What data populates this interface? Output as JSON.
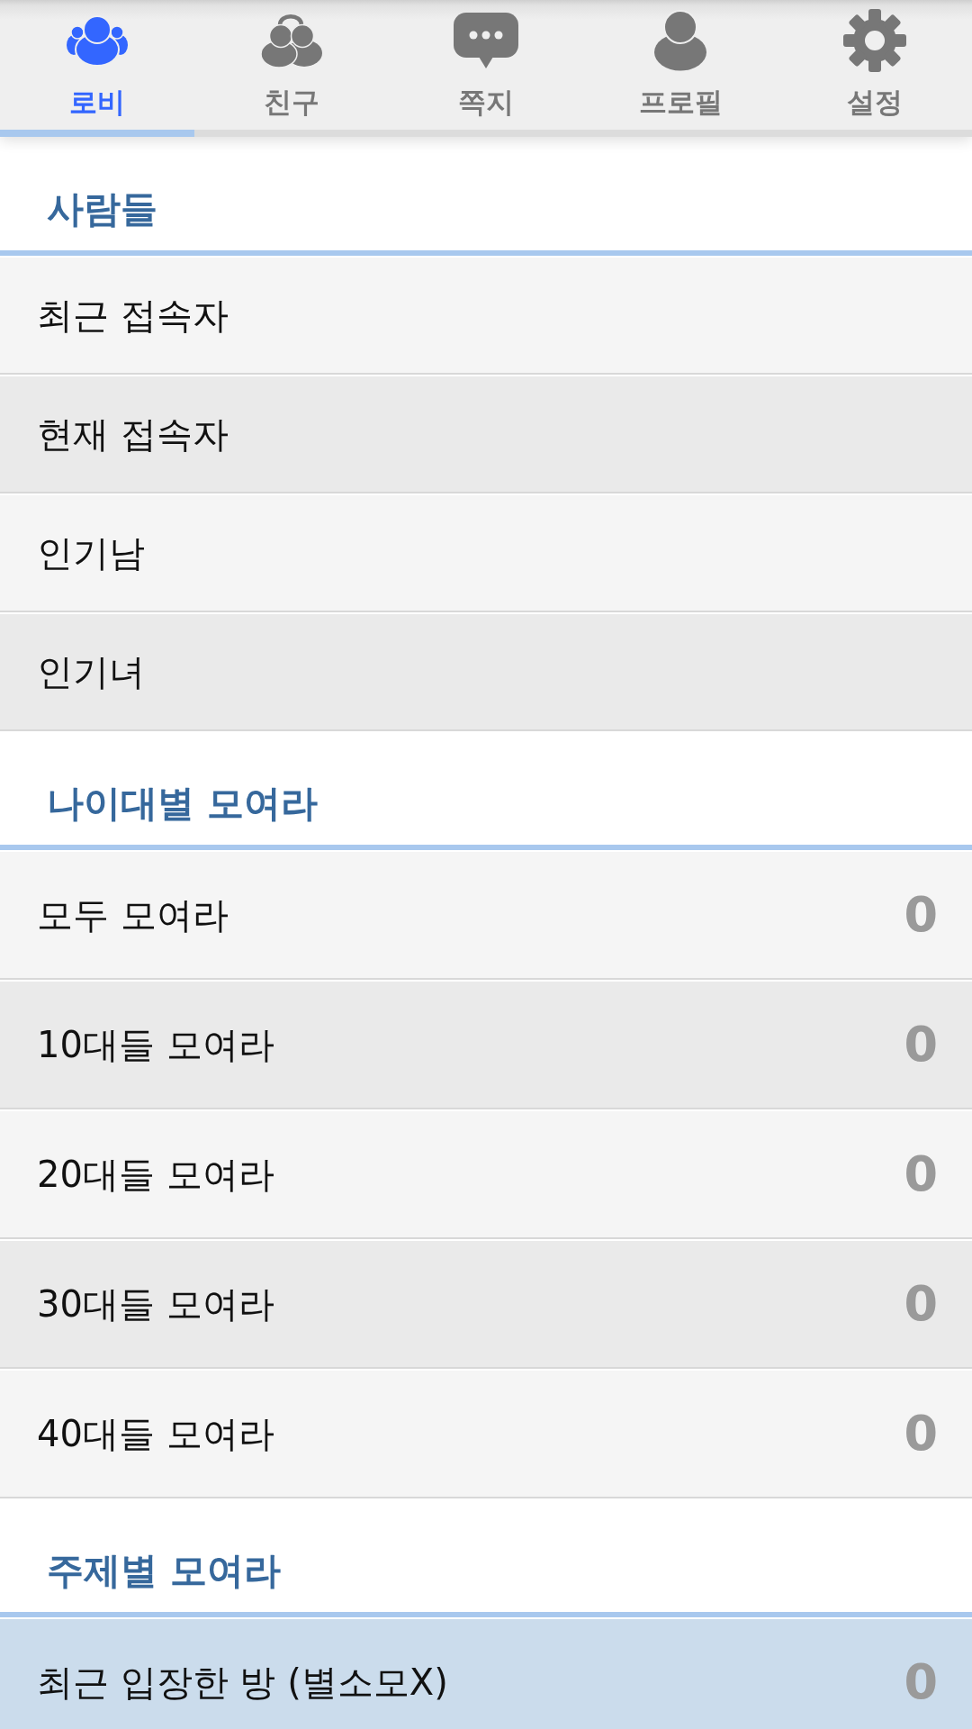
{
  "tabs": [
    {
      "kind": "lobby",
      "label": "로비",
      "selected": true
    },
    {
      "kind": "friends",
      "label": "친구",
      "selected": false
    },
    {
      "kind": "messages",
      "label": "쪽지",
      "selected": false
    },
    {
      "kind": "profile",
      "label": "프로필",
      "selected": false
    },
    {
      "kind": "settings",
      "label": "설정",
      "selected": false
    }
  ],
  "sections": [
    {
      "title": "사람들",
      "rows": [
        {
          "label": "최근 접속자",
          "selected": false
        },
        {
          "label": "현재 접속자",
          "selected": false
        },
        {
          "label": "인기남",
          "selected": false
        },
        {
          "label": "인기녀",
          "selected": false
        }
      ]
    },
    {
      "title": "나이대별 모여라",
      "rows": [
        {
          "label": "모두 모여라",
          "count": "0",
          "selected": false
        },
        {
          "label": "10대들 모여라",
          "count": "0",
          "selected": false
        },
        {
          "label": "20대들 모여라",
          "count": "0",
          "selected": false
        },
        {
          "label": "30대들 모여라",
          "count": "0",
          "selected": false
        },
        {
          "label": "40대들 모여라",
          "count": "0",
          "selected": false
        }
      ]
    },
    {
      "title": "주제별 모여라",
      "rows": [
        {
          "label": "최근 입장한 방 (별소모X)",
          "count": "0",
          "selected": true
        }
      ]
    }
  ]
}
